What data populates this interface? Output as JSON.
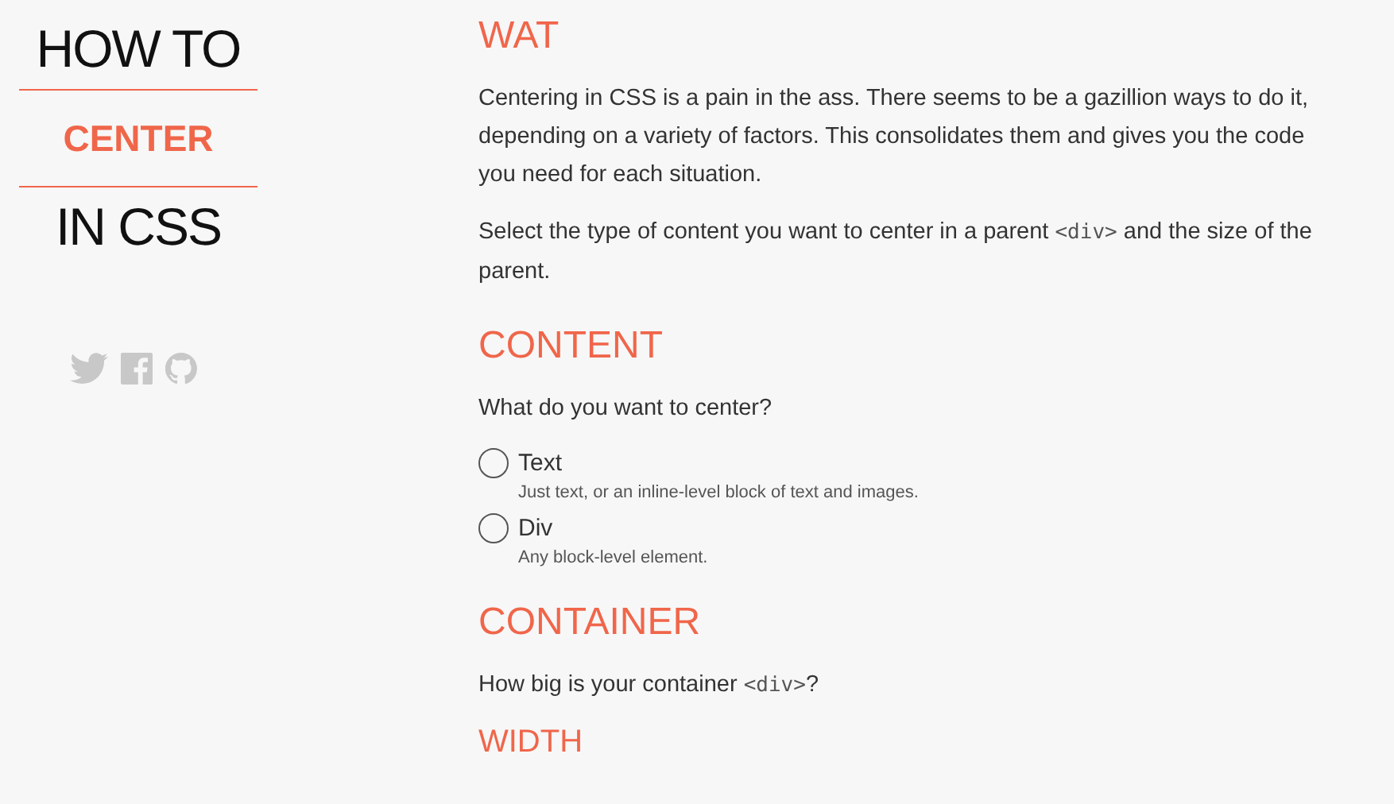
{
  "logo": {
    "line_1": "HOW TO",
    "line_2": "CENTER",
    "line_3": "IN CSS"
  },
  "social_icons": [
    {
      "kind": "twitter"
    },
    {
      "kind": "facebook"
    },
    {
      "kind": "github"
    }
  ],
  "sections": [
    {
      "heading": "WAT",
      "paragraphs": [
        [
          {
            "kind": "text",
            "text": "Centering in CSS is a pain in the ass. There seems to be a gazillion ways to do it, depending on a variety of factors. This consolidates them and gives you the code you need for each situation."
          }
        ],
        [
          {
            "kind": "text",
            "text": "Select the type of content you want to center in a parent "
          },
          {
            "kind": "code",
            "text": "<div>"
          },
          {
            "kind": "text",
            "text": " and the size of the parent."
          }
        ]
      ]
    },
    {
      "heading": "CONTENT",
      "paragraphs": [
        [
          {
            "kind": "text",
            "text": "What do you want to center?"
          }
        ]
      ],
      "options": [
        {
          "label": "Text",
          "description": "Just text, or an inline-level block of text and images.",
          "selected": false
        },
        {
          "label": "Div",
          "description": "Any block-level element.",
          "selected": false
        }
      ]
    },
    {
      "heading": "CONTAINER",
      "paragraphs": [
        [
          {
            "kind": "text",
            "text": "How big is your container "
          },
          {
            "kind": "code",
            "text": "<div>"
          },
          {
            "kind": "text",
            "text": "?"
          }
        ]
      ],
      "subheading": "WIDTH"
    }
  ]
}
